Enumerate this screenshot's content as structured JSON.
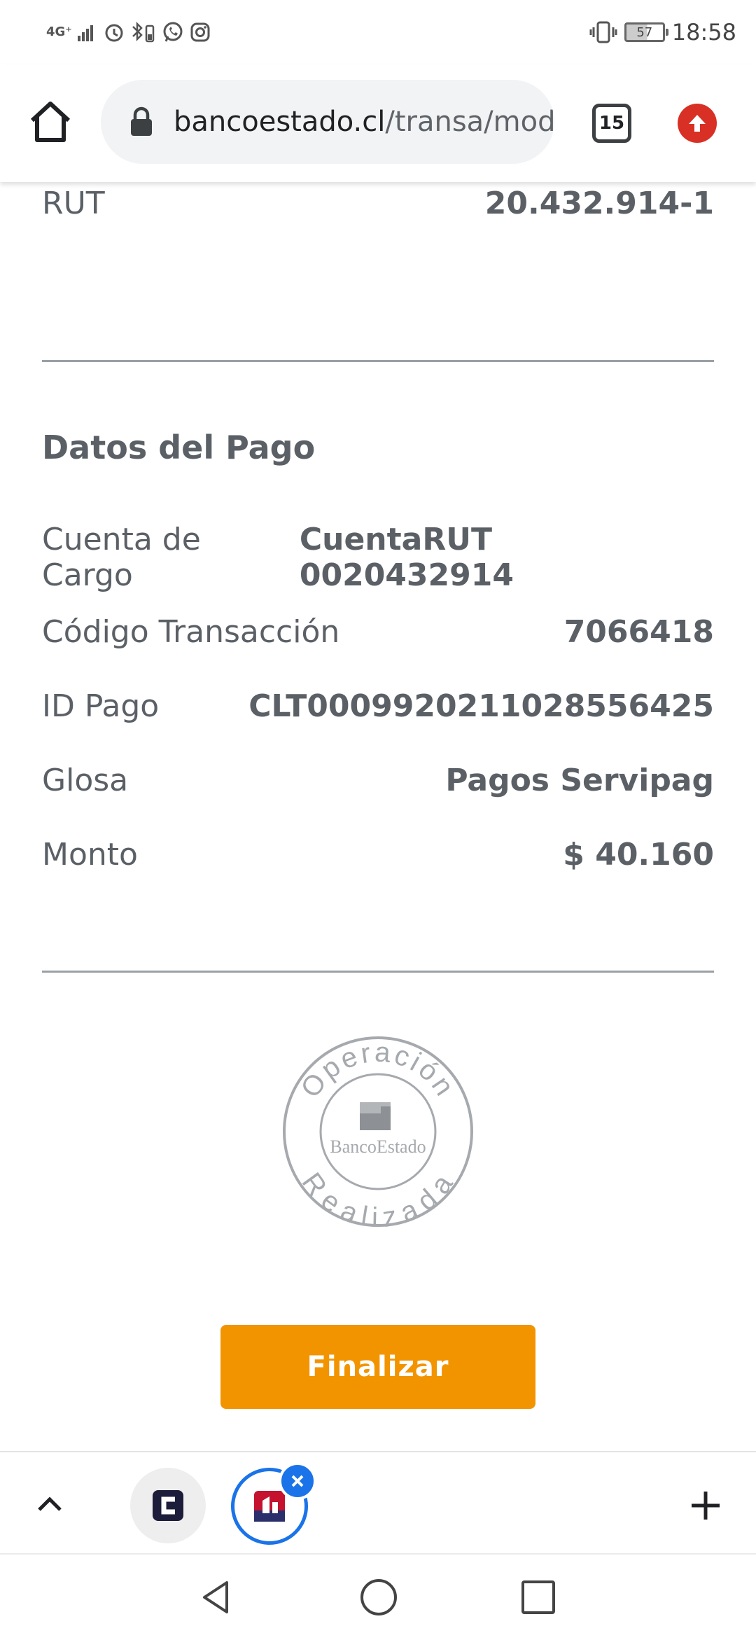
{
  "status_bar": {
    "network_label": "4G⁺",
    "time": "18:58",
    "battery_level": "57"
  },
  "browser": {
    "url_domain": "bancoestado.cl",
    "url_path": "/transa/mod_",
    "tab_count": "15"
  },
  "page": {
    "rut_label": "RUT",
    "rut_value": "20.432.914-1",
    "section_title": "Datos del Pago",
    "rows": [
      {
        "label": "Cuenta de Cargo",
        "value": "CuentaRUT 0020432914"
      },
      {
        "label": "Código Transacción",
        "value": "7066418"
      },
      {
        "label": "ID Pago",
        "value": "CLT00099202110285564​25"
      },
      {
        "label": "Glosa",
        "value": "Pagos Servipag"
      },
      {
        "label": "Monto",
        "value": "$ 40.160"
      }
    ],
    "stamp": {
      "top_text": "Operación",
      "center_text": "BancoEstado",
      "bottom_text": "Realizada"
    },
    "finalizar_label": "Finalizar"
  },
  "colors": {
    "accent_orange": "#f29400",
    "text_gray": "#5b6066",
    "divider": "#9aa0a6",
    "update_red": "#d93025",
    "active_tab_blue": "#1a73e8"
  }
}
